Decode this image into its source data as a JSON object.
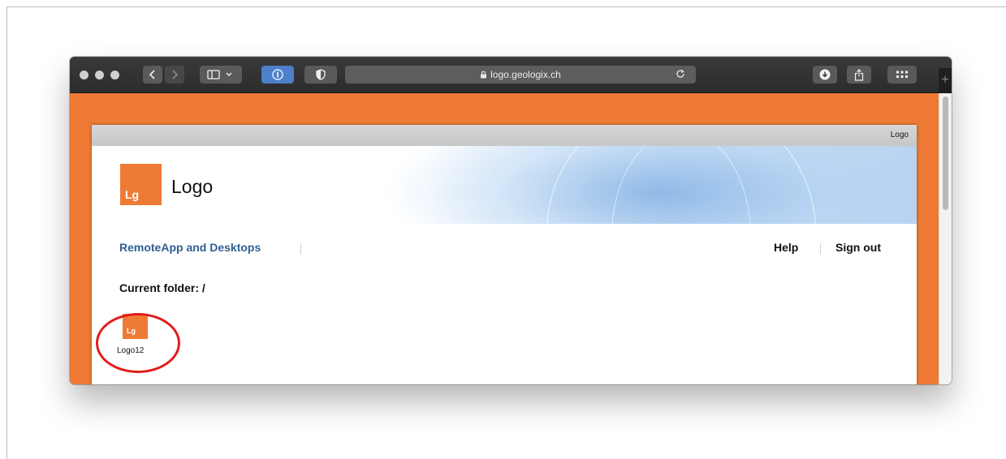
{
  "browser": {
    "url": "logo.geologix.ch",
    "new_tab_symbol": "+"
  },
  "page": {
    "topbar_label": "Logo",
    "logo_initials": "Lg",
    "site_title": "Logo",
    "nav": {
      "remoteapp": "RemoteApp and Desktops",
      "help": "Help",
      "sign_out": "Sign out"
    },
    "current_folder": "Current folder: /",
    "apps": [
      {
        "initials": "Lg",
        "label": "Logo12"
      }
    ]
  },
  "colors": {
    "brand_orange": "#ee7b35",
    "nav_link_blue": "#2f5f94",
    "annotation_red": "#e31b1b"
  }
}
